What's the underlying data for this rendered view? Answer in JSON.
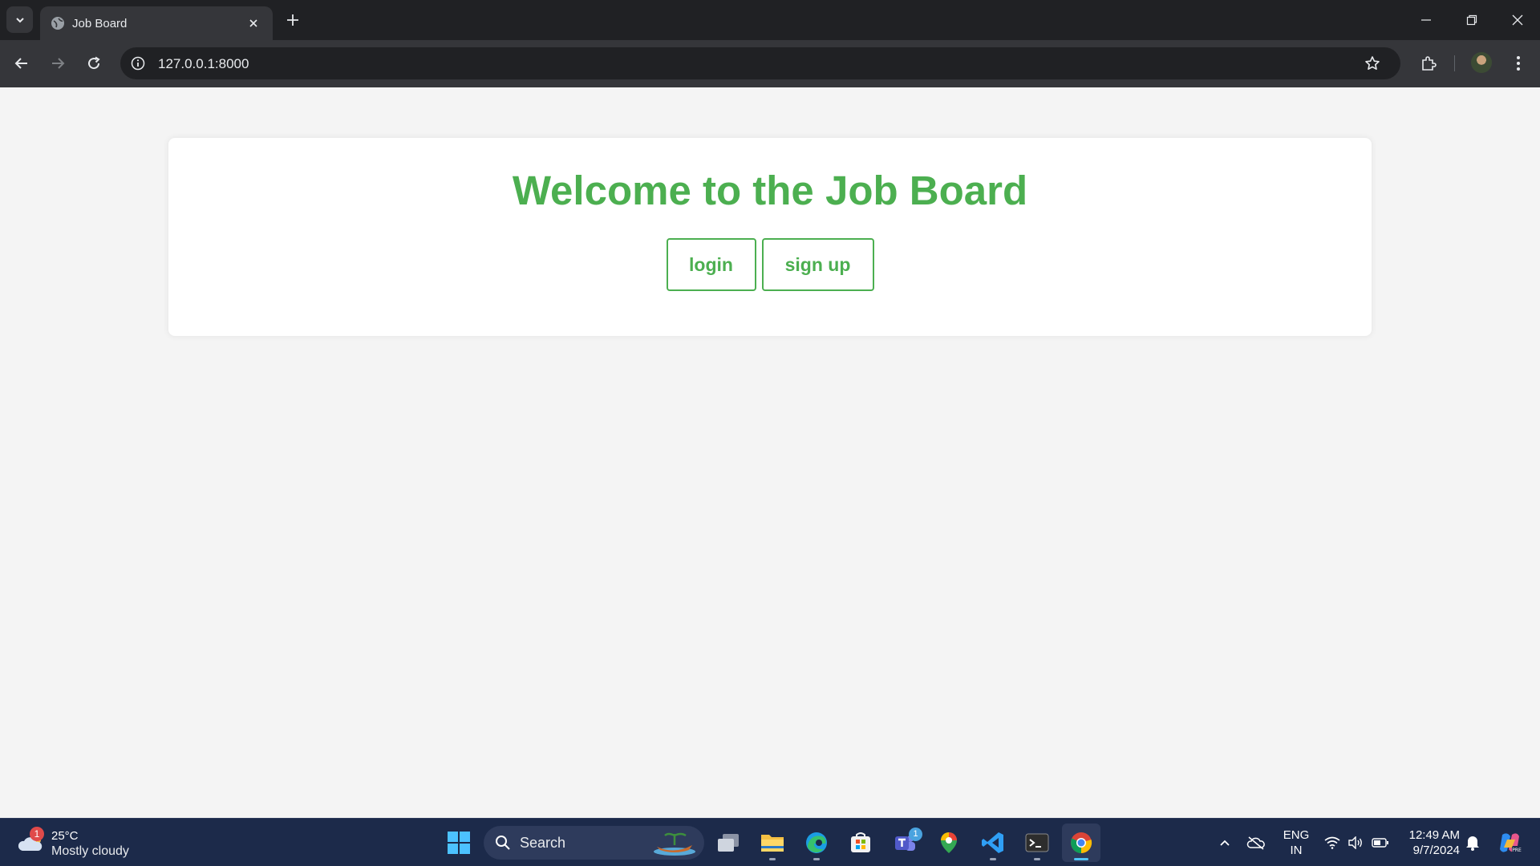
{
  "browser": {
    "tab": {
      "title": "Job Board"
    },
    "address_bar": {
      "url": "127.0.0.1:8000"
    }
  },
  "page": {
    "heading": "Welcome to the Job Board",
    "buttons": {
      "login": "login",
      "signup": "sign up"
    },
    "accent_color": "#4caf50",
    "background_color": "#f4f4f4"
  },
  "taskbar": {
    "weather": {
      "temperature": "25°C",
      "description": "Mostly cloudy",
      "badge": "1"
    },
    "search_label": "Search",
    "teams_badge": "1",
    "language": {
      "line1": "ENG",
      "line2": "IN"
    },
    "clock": {
      "time": "12:49 AM",
      "date": "9/7/2024"
    },
    "accent_color": "#1c2a4a"
  }
}
